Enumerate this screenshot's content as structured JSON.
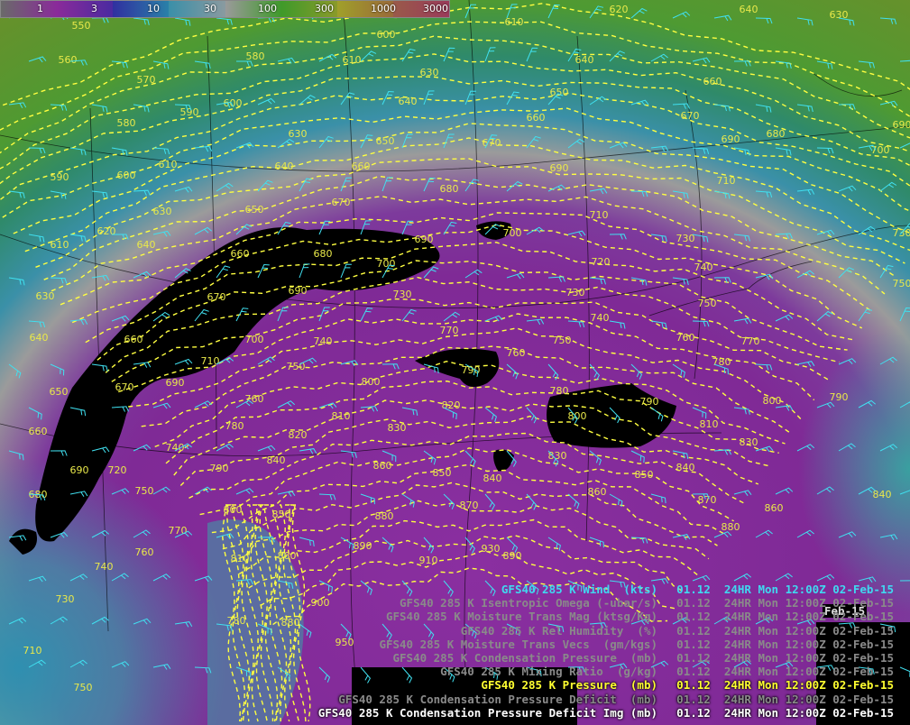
{
  "colorbar": {
    "labels": [
      "1",
      "3",
      "10",
      "30",
      "100",
      "300",
      "1000",
      "3000"
    ],
    "colors": [
      "#7a7a7a",
      "#8a2a9a",
      "#3030a0",
      "#3a8fa8",
      "#9a9a9a",
      "#3f9a2a",
      "#a0a02a",
      "#9a3a4a"
    ]
  },
  "map": {
    "background": [
      "#5aa23a",
      "#6c8f2a",
      "#9b9b9b",
      "#3a90a8",
      "#8a2fa0",
      "#7f2a96"
    ],
    "contour_color": "#ffff40",
    "barb_color": "#40e0f0",
    "isobar_labels": [
      {
        "t": "550"
      },
      {
        "t": "560"
      },
      {
        "t": "570"
      },
      {
        "t": "580"
      },
      {
        "t": "590"
      },
      {
        "t": "600"
      },
      {
        "t": "610"
      },
      {
        "t": "620"
      },
      {
        "t": "630"
      },
      {
        "t": "640"
      },
      {
        "t": "650"
      },
      {
        "t": "660"
      },
      {
        "t": "670"
      },
      {
        "t": "680"
      },
      {
        "t": "690"
      },
      {
        "t": "700"
      },
      {
        "t": "710"
      },
      {
        "t": "720"
      },
      {
        "t": "730"
      },
      {
        "t": "740"
      },
      {
        "t": "750"
      },
      {
        "t": "760"
      },
      {
        "t": "770"
      },
      {
        "t": "780"
      },
      {
        "t": "790"
      },
      {
        "t": "800"
      },
      {
        "t": "810"
      },
      {
        "t": "820"
      },
      {
        "t": "830"
      },
      {
        "t": "840"
      },
      {
        "t": "850"
      },
      {
        "t": "860"
      },
      {
        "t": "870"
      },
      {
        "t": "880"
      },
      {
        "t": "890"
      },
      {
        "t": "900"
      },
      {
        "t": "910"
      },
      {
        "t": "930"
      },
      {
        "t": "950"
      }
    ]
  },
  "legend": [
    {
      "name": "GFS40 285 K Wind  (kts)",
      "time": "01.12  24HR Mon 12:00Z 02-Feb-15",
      "color": "#40d8f0"
    },
    {
      "name": "GFS40 285 K Isentropic Omega (-ubar/s)",
      "time": "01.12  24HR Mon 12:00Z 02-Feb-15",
      "color": "#8a8a8a"
    },
    {
      "name": "GFS40 285 K Moisture Trans Mag (ktsg/Kg)",
      "time": "01.12  24HR Mon 12:00Z 02-Feb-15",
      "color": "#8a8a8a"
    },
    {
      "name": "GFS40 285 K Rel Humidity  (%)",
      "time": "01.12  24HR Mon 12:00Z 02-Feb-15",
      "color": "#8a8a8a"
    },
    {
      "name": "GFS40 285 K Moisture Trans Vecs  (gm/kgs)",
      "time": "01.12  24HR Mon 12:00Z 02-Feb-15",
      "color": "#8a8a8a"
    },
    {
      "name": "GFS40 285 K Condensation Pressure  (mb)",
      "time": "01.12  24HR Mon 12:00Z 02-Feb-15",
      "color": "#8a8a8a"
    },
    {
      "name": "GFS40 285 K Mixing Ratio  (g/kg)",
      "time": "01.12  24HR Mon 12:00Z 02-Feb-15",
      "color": "#8a8a8a"
    },
    {
      "name": "GFS40 285 K Pressure  (mb)",
      "time": "01.12  24HR Mon 12:00Z 02-Feb-15",
      "color": "#ffff30"
    },
    {
      "name": "GFS40 285 K Condensation Pressure Deficit  (mb)",
      "time": "01.12  24HR Mon 12:00Z 02-Feb-15",
      "color": "#8a8a8a"
    },
    {
      "name": "GFS40 285 K Condensation Pressure Deficit Img (mb)",
      "time": "01.12  24HR Mon 12:00Z 02-Feb-15",
      "color": "#ffffff"
    }
  ],
  "partial_overlay": "Feb-15"
}
